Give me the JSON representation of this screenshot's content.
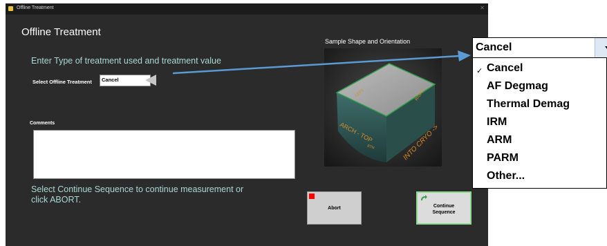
{
  "window": {
    "title": "Offline Treatment"
  },
  "main": {
    "title": "Offline Treatment",
    "instruction": "Enter Type of treatment used and treatment value",
    "select_label": "Select Offline Treatment",
    "select_value": "Cancel",
    "comments_label": "Comments",
    "comments_value": "",
    "continue_instruction": "Select Continue Sequence to continue measurement or click ABORT."
  },
  "sample": {
    "label": "Sample Shape and Orientation",
    "face_labels": {
      "arch": "ARCH - TOP",
      "left": "LEFT",
      "right": "RIGHT",
      "into": "INTO CRYO ->",
      "bottom": "BTM"
    }
  },
  "buttons": {
    "abort": "Abort",
    "continue_line1": "Continue",
    "continue_line2": "Sequence"
  },
  "dropdown": {
    "selected": "Cancel",
    "options": [
      "Cancel",
      "AF Degmag",
      "Thermal Demag",
      "IRM",
      "ARM",
      "PARM",
      "Other..."
    ],
    "checked_index": 0
  },
  "colors": {
    "window_bg": "#2b2b2b",
    "instruction_text": "#a9d9d2",
    "arrow": "#5b9bd5",
    "continue_border": "#8bd98b",
    "abort_indicator": "#ff0000"
  },
  "icons": {
    "app": "app-icon",
    "close": "close-icon",
    "abort_indicator": "abort-indicator-icon",
    "continue": "continue-icon",
    "dropdown": "chevron-down-icon",
    "check": "check-icon"
  }
}
